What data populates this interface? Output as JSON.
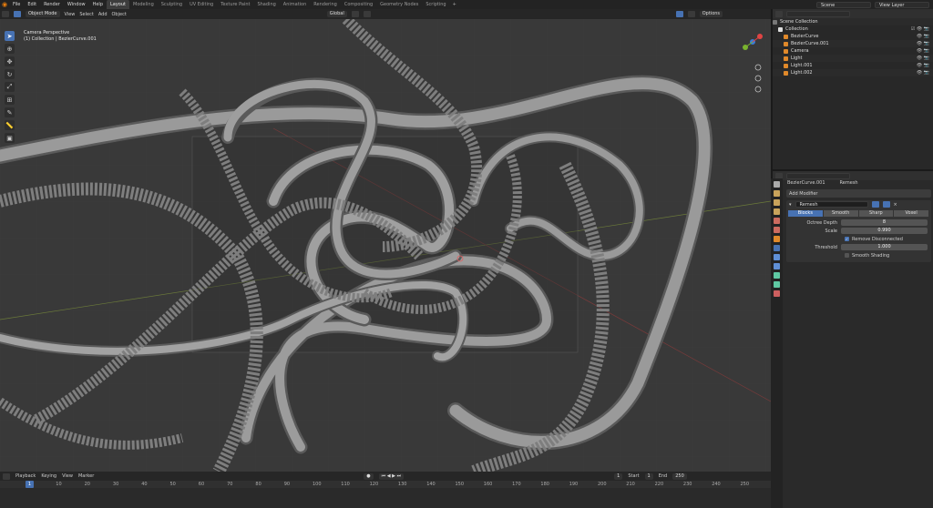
{
  "topbar": {
    "menus": [
      "File",
      "Edit",
      "Render",
      "Window",
      "Help"
    ],
    "workspaces": [
      "Layout",
      "Modeling",
      "Sculpting",
      "UV Editing",
      "Texture Paint",
      "Shading",
      "Animation",
      "Rendering",
      "Compositing",
      "Geometry Nodes",
      "Scripting"
    ],
    "active_workspace": "Layout",
    "scene": "Scene",
    "view_layer": "View Layer"
  },
  "viewport": {
    "mode": "Object Mode",
    "menus": [
      "View",
      "Select",
      "Add",
      "Object"
    ],
    "transform_orientation": "Global",
    "options_label": "Options",
    "overlay_line1": "Camera Perspective",
    "overlay_line2": "(1) Collection | BezierCurve.001"
  },
  "outliner": {
    "root": "Scene Collection",
    "collection": "Collection",
    "items": [
      {
        "name": "BezierCurve",
        "color": "#e0892a"
      },
      {
        "name": "BezierCurve.001",
        "color": "#e0892a"
      },
      {
        "name": "Camera",
        "color": "#e0892a"
      },
      {
        "name": "Light",
        "color": "#e0892a"
      },
      {
        "name": "Light.001",
        "color": "#e0892a"
      },
      {
        "name": "Light.002",
        "color": "#e0892a"
      }
    ]
  },
  "properties": {
    "object_name": "BezierCurve.001",
    "modifier_type": "Remesh",
    "add_modifier": "Add Modifier",
    "modifier_name": "Remesh",
    "modes": [
      "Blocks",
      "Smooth",
      "Sharp",
      "Voxel"
    ],
    "active_mode": "Blocks",
    "octree_depth_label": "Octree Depth",
    "octree_depth": "8",
    "scale_label": "Scale",
    "scale": "0.990",
    "remove_disconnected": "Remove Disconnected",
    "threshold_label": "Threshold",
    "threshold": "1.000",
    "smooth_shading": "Smooth Shading"
  },
  "timeline": {
    "menus": [
      "Playback",
      "Keying",
      "View",
      "Marker"
    ],
    "current_frame": "1",
    "start_label": "Start",
    "start": "1",
    "end_label": "End",
    "end": "250",
    "ticks": [
      "1",
      "10",
      "20",
      "30",
      "40",
      "50",
      "60",
      "70",
      "80",
      "90",
      "100",
      "110",
      "120",
      "130",
      "140",
      "150",
      "160",
      "170",
      "180",
      "190",
      "200",
      "210",
      "220",
      "230",
      "240",
      "250"
    ]
  },
  "colors": {
    "accent": "#4772b3",
    "curve": "#8e8e8e",
    "background": "#3a3a3a"
  }
}
